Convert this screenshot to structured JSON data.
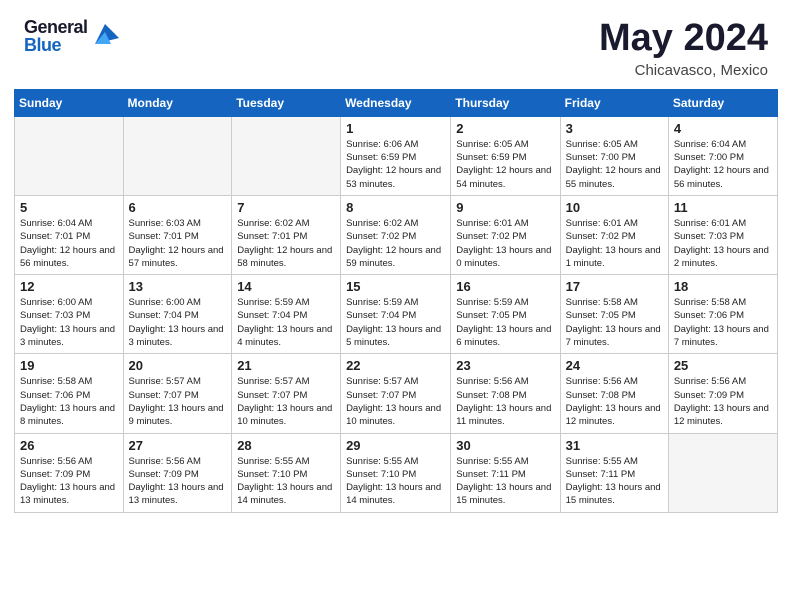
{
  "header": {
    "logo_general": "General",
    "logo_blue": "Blue",
    "month_title": "May 2024",
    "location": "Chicavasco, Mexico"
  },
  "weekdays": [
    "Sunday",
    "Monday",
    "Tuesday",
    "Wednesday",
    "Thursday",
    "Friday",
    "Saturday"
  ],
  "weeks": [
    [
      {
        "day": "",
        "text": ""
      },
      {
        "day": "",
        "text": ""
      },
      {
        "day": "",
        "text": ""
      },
      {
        "day": "1",
        "text": "Sunrise: 6:06 AM\nSunset: 6:59 PM\nDaylight: 12 hours and 53 minutes."
      },
      {
        "day": "2",
        "text": "Sunrise: 6:05 AM\nSunset: 6:59 PM\nDaylight: 12 hours and 54 minutes."
      },
      {
        "day": "3",
        "text": "Sunrise: 6:05 AM\nSunset: 7:00 PM\nDaylight: 12 hours and 55 minutes."
      },
      {
        "day": "4",
        "text": "Sunrise: 6:04 AM\nSunset: 7:00 PM\nDaylight: 12 hours and 56 minutes."
      }
    ],
    [
      {
        "day": "5",
        "text": "Sunrise: 6:04 AM\nSunset: 7:01 PM\nDaylight: 12 hours and 56 minutes."
      },
      {
        "day": "6",
        "text": "Sunrise: 6:03 AM\nSunset: 7:01 PM\nDaylight: 12 hours and 57 minutes."
      },
      {
        "day": "7",
        "text": "Sunrise: 6:02 AM\nSunset: 7:01 PM\nDaylight: 12 hours and 58 minutes."
      },
      {
        "day": "8",
        "text": "Sunrise: 6:02 AM\nSunset: 7:02 PM\nDaylight: 12 hours and 59 minutes."
      },
      {
        "day": "9",
        "text": "Sunrise: 6:01 AM\nSunset: 7:02 PM\nDaylight: 13 hours and 0 minutes."
      },
      {
        "day": "10",
        "text": "Sunrise: 6:01 AM\nSunset: 7:02 PM\nDaylight: 13 hours and 1 minute."
      },
      {
        "day": "11",
        "text": "Sunrise: 6:01 AM\nSunset: 7:03 PM\nDaylight: 13 hours and 2 minutes."
      }
    ],
    [
      {
        "day": "12",
        "text": "Sunrise: 6:00 AM\nSunset: 7:03 PM\nDaylight: 13 hours and 3 minutes."
      },
      {
        "day": "13",
        "text": "Sunrise: 6:00 AM\nSunset: 7:04 PM\nDaylight: 13 hours and 3 minutes."
      },
      {
        "day": "14",
        "text": "Sunrise: 5:59 AM\nSunset: 7:04 PM\nDaylight: 13 hours and 4 minutes."
      },
      {
        "day": "15",
        "text": "Sunrise: 5:59 AM\nSunset: 7:04 PM\nDaylight: 13 hours and 5 minutes."
      },
      {
        "day": "16",
        "text": "Sunrise: 5:59 AM\nSunset: 7:05 PM\nDaylight: 13 hours and 6 minutes."
      },
      {
        "day": "17",
        "text": "Sunrise: 5:58 AM\nSunset: 7:05 PM\nDaylight: 13 hours and 7 minutes."
      },
      {
        "day": "18",
        "text": "Sunrise: 5:58 AM\nSunset: 7:06 PM\nDaylight: 13 hours and 7 minutes."
      }
    ],
    [
      {
        "day": "19",
        "text": "Sunrise: 5:58 AM\nSunset: 7:06 PM\nDaylight: 13 hours and 8 minutes."
      },
      {
        "day": "20",
        "text": "Sunrise: 5:57 AM\nSunset: 7:07 PM\nDaylight: 13 hours and 9 minutes."
      },
      {
        "day": "21",
        "text": "Sunrise: 5:57 AM\nSunset: 7:07 PM\nDaylight: 13 hours and 10 minutes."
      },
      {
        "day": "22",
        "text": "Sunrise: 5:57 AM\nSunset: 7:07 PM\nDaylight: 13 hours and 10 minutes."
      },
      {
        "day": "23",
        "text": "Sunrise: 5:56 AM\nSunset: 7:08 PM\nDaylight: 13 hours and 11 minutes."
      },
      {
        "day": "24",
        "text": "Sunrise: 5:56 AM\nSunset: 7:08 PM\nDaylight: 13 hours and 12 minutes."
      },
      {
        "day": "25",
        "text": "Sunrise: 5:56 AM\nSunset: 7:09 PM\nDaylight: 13 hours and 12 minutes."
      }
    ],
    [
      {
        "day": "26",
        "text": "Sunrise: 5:56 AM\nSunset: 7:09 PM\nDaylight: 13 hours and 13 minutes."
      },
      {
        "day": "27",
        "text": "Sunrise: 5:56 AM\nSunset: 7:09 PM\nDaylight: 13 hours and 13 minutes."
      },
      {
        "day": "28",
        "text": "Sunrise: 5:55 AM\nSunset: 7:10 PM\nDaylight: 13 hours and 14 minutes."
      },
      {
        "day": "29",
        "text": "Sunrise: 5:55 AM\nSunset: 7:10 PM\nDaylight: 13 hours and 14 minutes."
      },
      {
        "day": "30",
        "text": "Sunrise: 5:55 AM\nSunset: 7:11 PM\nDaylight: 13 hours and 15 minutes."
      },
      {
        "day": "31",
        "text": "Sunrise: 5:55 AM\nSunset: 7:11 PM\nDaylight: 13 hours and 15 minutes."
      },
      {
        "day": "",
        "text": ""
      }
    ]
  ]
}
